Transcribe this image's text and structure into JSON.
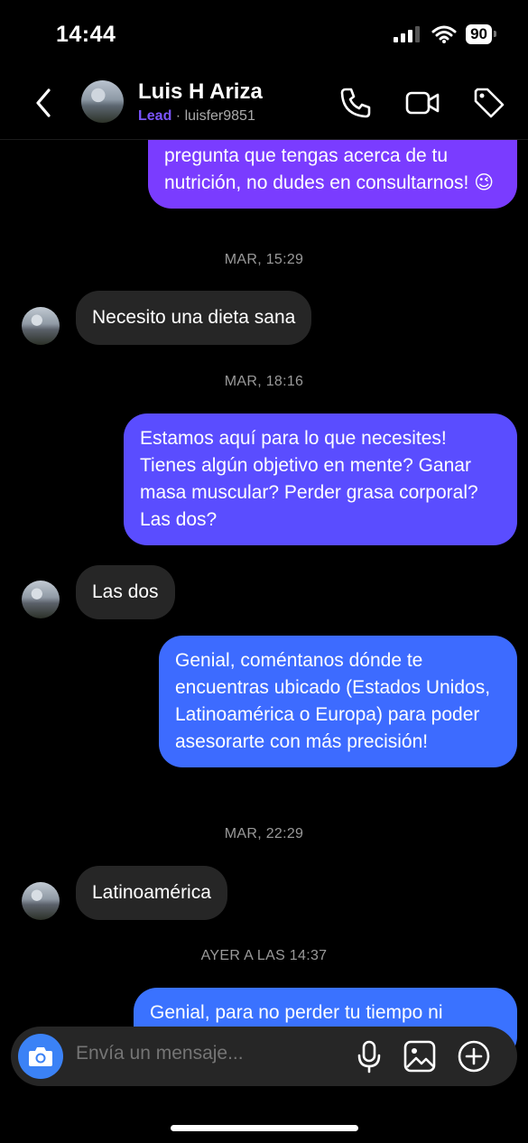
{
  "status_bar": {
    "time": "14:44",
    "battery": "90"
  },
  "header": {
    "name": "Luis H Ariza",
    "label": "Lead",
    "separator": "·",
    "username": "luisfer9851"
  },
  "messages": [
    {
      "direction": "out",
      "text": "pregunta que tengas acerca de tu nutrición, no dudes en consultarnos! 😉"
    },
    {
      "type": "stamp",
      "text": "MAR, 15:29"
    },
    {
      "direction": "in",
      "text": "Necesito una dieta sana"
    },
    {
      "type": "stamp",
      "text": "MAR, 18:16"
    },
    {
      "direction": "out",
      "text": "Estamos aquí para lo que necesites! Tienes algún objetivo en mente? Ganar masa muscular? Perder grasa corporal? Las dos?"
    },
    {
      "direction": "in",
      "text": "Las dos"
    },
    {
      "direction": "out",
      "text": "Genial, coméntanos dónde te encuentras ubicado (Estados Unidos, Latinoamérica o Europa) para poder asesorarte con más precisión!"
    },
    {
      "type": "stamp",
      "text": "MAR, 22:29"
    },
    {
      "direction": "in",
      "text": "Latinoamérica"
    },
    {
      "type": "stamp",
      "text": "AYER A LAS 14:37"
    },
    {
      "direction": "out",
      "text": "Genial, para no perder tu tiempo ni"
    }
  ],
  "composer": {
    "placeholder": "Envía un mensaje..."
  },
  "colors": {
    "bubble_purple": "#7a3cff",
    "bubble_blue": "#3d6bff",
    "incoming": "#262626",
    "lead": "#7b55ff",
    "camera": "#3b82f6"
  }
}
